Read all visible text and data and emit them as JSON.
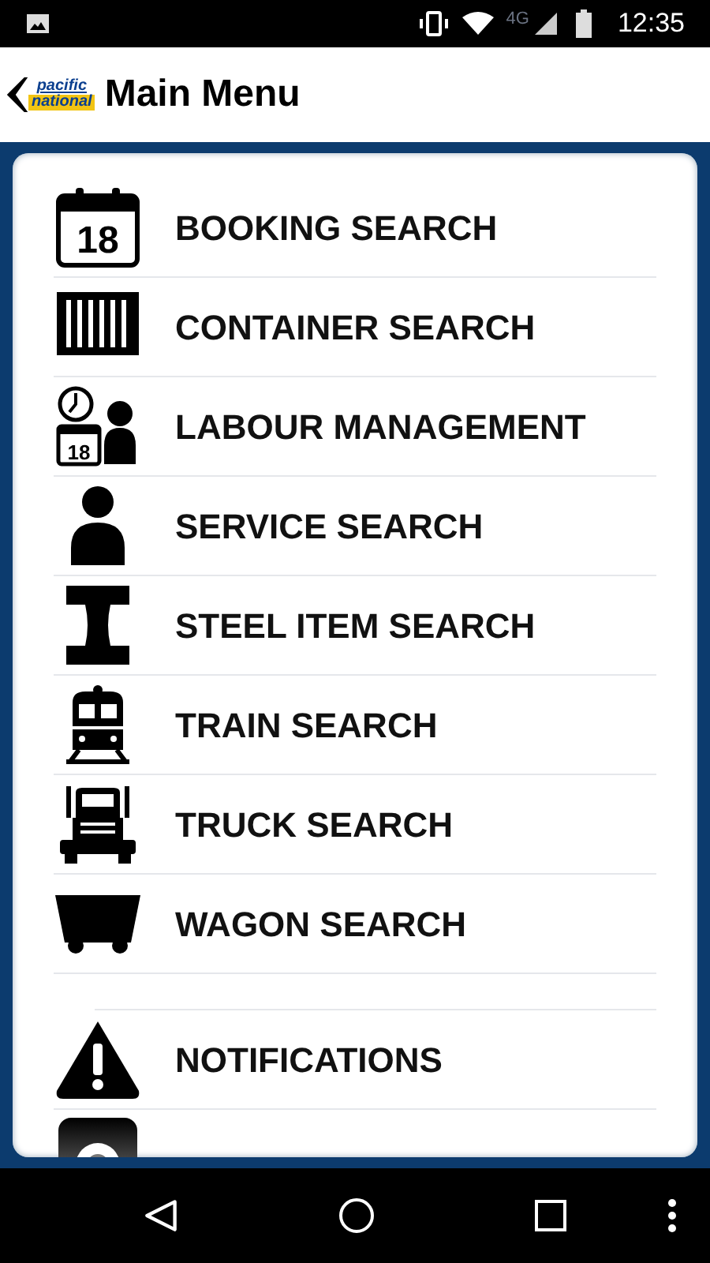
{
  "status_bar": {
    "network": "4G",
    "time": "12:35"
  },
  "header": {
    "logo_top": "pacific",
    "logo_bottom": "national",
    "title": "Main Menu"
  },
  "sections": [
    {
      "items": [
        {
          "kind": "calendar",
          "label": "BOOKING SEARCH",
          "calendar_day": "18"
        },
        {
          "kind": "container",
          "label": "CONTAINER SEARCH"
        },
        {
          "kind": "labour",
          "label": "LABOUR MANAGEMENT",
          "calendar_day": "18"
        },
        {
          "kind": "person",
          "label": "SERVICE SEARCH"
        },
        {
          "kind": "steel",
          "label": "STEEL ITEM SEARCH"
        },
        {
          "kind": "train",
          "label": "TRAIN SEARCH"
        },
        {
          "kind": "truck",
          "label": "TRUCK SEARCH"
        },
        {
          "kind": "wagon",
          "label": "WAGON SEARCH"
        }
      ]
    },
    {
      "items": [
        {
          "kind": "warning",
          "label": "NOTIFICATIONS"
        },
        {
          "kind": "gear"
        }
      ]
    }
  ]
}
